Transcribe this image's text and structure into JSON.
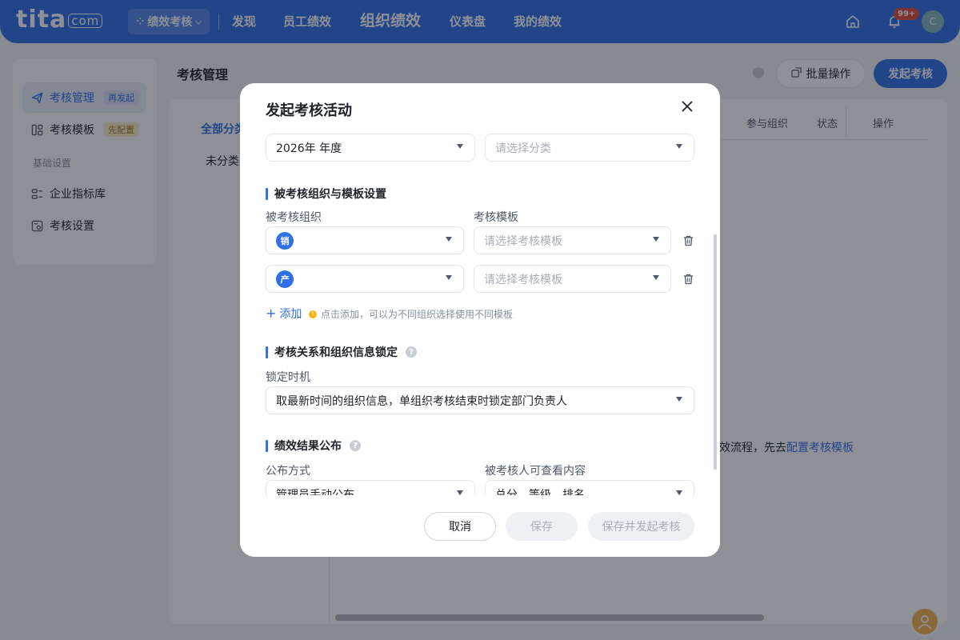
{
  "topbar": {
    "logo": "tita",
    "logo_suffix": "com",
    "module_switch": "绩效考核",
    "nav": [
      "发现",
      "员工绩效",
      "组织绩效",
      "仪表盘",
      "我的绩效"
    ],
    "active_nav": "组织绩效",
    "notification_badge": "99+",
    "avatar_letter": "C"
  },
  "sidebar": {
    "items": [
      {
        "label": "考核管理",
        "tag": "再发起"
      },
      {
        "label": "考核模板",
        "tag": "先配置"
      },
      {
        "label": "企业指标库"
      },
      {
        "label": "考核设置"
      }
    ],
    "section": "基础设置"
  },
  "page": {
    "title": "考核管理",
    "batch_button": "批量操作",
    "launch_button": "发起考核",
    "category_all": "全部分类",
    "category_none": "未分类",
    "columns": [
      "参与组织",
      "状态",
      "操作"
    ],
    "empty_prefix": "效流程，先去",
    "empty_link": "配置考核模板"
  },
  "modal": {
    "title": "发起考核活动",
    "year_value": "2026年 年度",
    "category_placeholder": "请选择分类",
    "section_org": "被考核组织与模板设置",
    "label_org": "被考核组织",
    "label_template": "考核模板",
    "org_rows": [
      {
        "chip": "销",
        "template_placeholder": "请选择考核模板"
      },
      {
        "chip": "产",
        "template_placeholder": "请选择考核模板"
      }
    ],
    "add_label": "添加",
    "add_tip": "点击添加，可以为不同组织选择使用不同模板",
    "section_lock": "考核关系和组织信息锁定",
    "label_lock_time": "锁定时机",
    "lock_value": "取最新时间的组织信息，单组织考核结束时锁定部门负责人",
    "section_publish": "绩效结果公布",
    "label_publish_mode": "公布方式",
    "publish_mode_value": "管理员手动公布",
    "label_viewable": "被考核人可查看内容",
    "viewable_value": "总分、等级、排名",
    "btn_cancel": "取消",
    "btn_save": "保存",
    "btn_submit": "保存并发起考核"
  },
  "colors": {
    "brand": "#2f6fe8",
    "overlay": "rgba(20,24,35,0.48)"
  }
}
